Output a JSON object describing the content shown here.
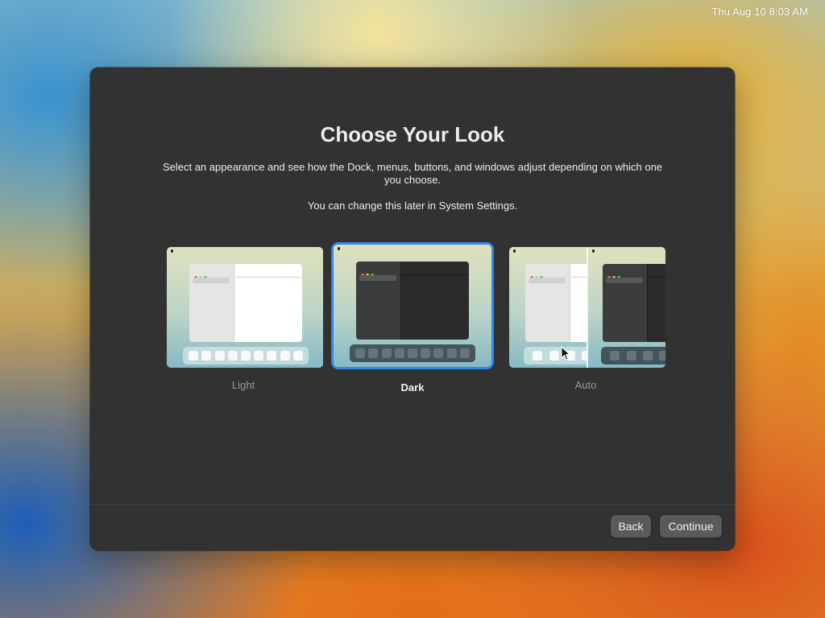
{
  "menubar": {
    "clock": "Thu Aug 10 8:03 AM"
  },
  "dialog": {
    "title": "Choose Your Look",
    "description": "Select an appearance and see how the Dock, menus, buttons, and windows adjust depending on which one you choose.",
    "note": "You can change this later in System Settings.",
    "options": [
      {
        "label": "Light",
        "selected": false
      },
      {
        "label": "Dark",
        "selected": true
      },
      {
        "label": "Auto",
        "selected": false
      }
    ],
    "buttons": {
      "back": "Back",
      "continue": "Continue"
    }
  },
  "colors": {
    "window_bg": "#323232",
    "selection_accent": "#2f87f0",
    "button_bg": "#5a5a5a"
  },
  "icons": [
    "apple-logo-icon",
    "mouse-pointer-icon"
  ]
}
